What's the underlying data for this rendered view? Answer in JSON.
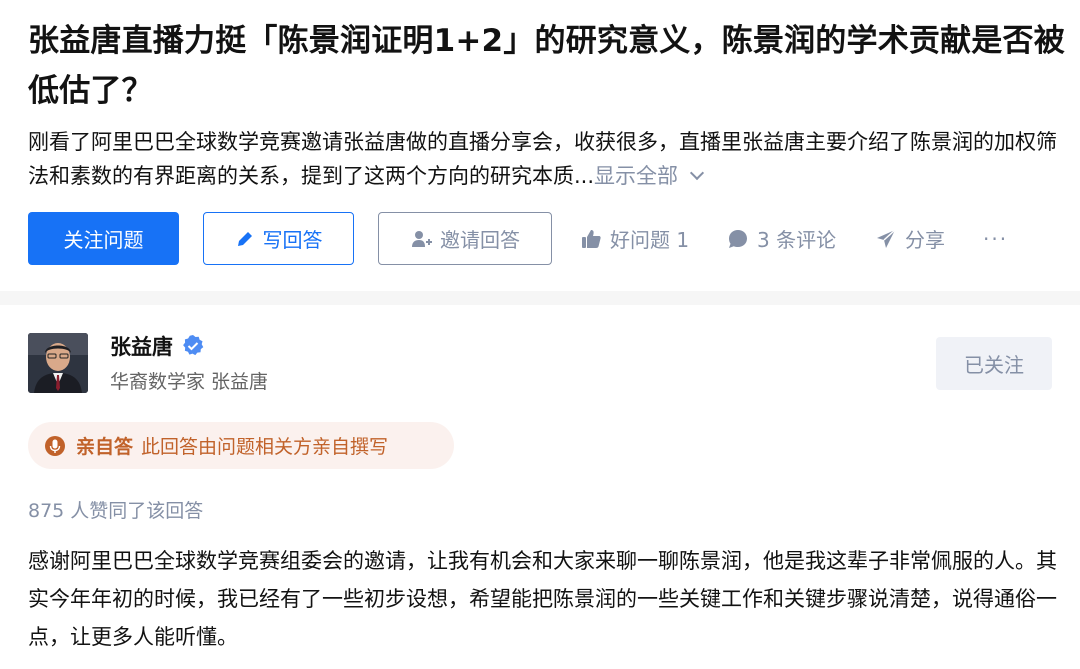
{
  "question": {
    "title": "张益唐直播力挺「陈景润证明1+2」的研究意义，陈景润的学术贡献是否被低估了？",
    "excerpt": "刚看了阿里巴巴全球数学竞赛邀请张益唐做的直播分享会，收获很多，直播里张益唐主要介绍了陈景润的加权筛法和素数的有界距离的关系，提到了这两个方向的研究本质...",
    "show_all": "显示全部"
  },
  "actions": {
    "follow": "关注问题",
    "write": "写回答",
    "invite": "邀请回答",
    "good_question": "好问题 1",
    "comments": "3 条评论",
    "share": "分享",
    "more": "···"
  },
  "answer": {
    "author_name": "张益唐",
    "author_bio": "华裔数学家 张益唐",
    "followed": "已关注",
    "self_badge_strong": "亲自答",
    "self_badge_text": "此回答由问题相关方亲自撰写",
    "votes": "875 人赞同了该回答",
    "content": "感谢阿里巴巴全球数学竞赛组委会的邀请，让我有机会和大家来聊一聊陈景润，他是我这辈子非常佩服的人。其实今年年初的时候，我已经有了一些初步设想，希望能把陈景润的一些关键工作和关键步骤说清楚，说得通俗一点，让更多人能听懂。"
  },
  "colors": {
    "accent": "#1772f6",
    "muted": "#8590a6",
    "badge_bg": "#fbf1ee",
    "badge_text": "#c1622a"
  }
}
